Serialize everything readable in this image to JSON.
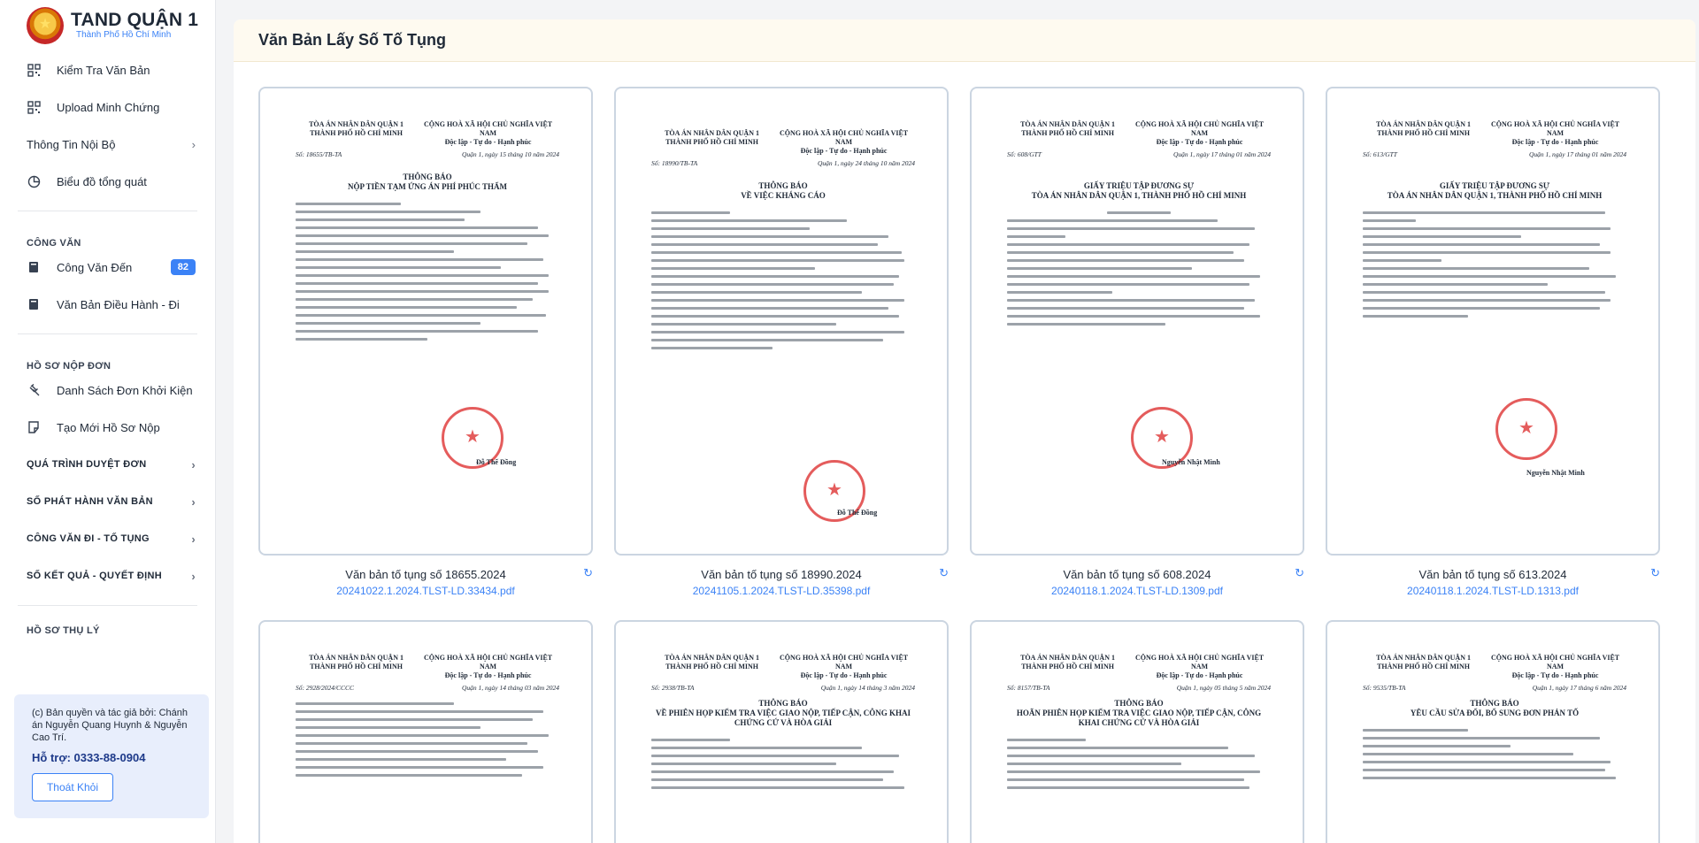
{
  "brand": {
    "title": "TAND QUẬN 1",
    "subtitle": "Thành Phố Hồ Chí Minh"
  },
  "nav": {
    "check_docs": "Kiểm Tra Văn Bản",
    "upload_proof": "Upload Minh Chứng",
    "internal_info": "Thông Tin Nội Bộ",
    "overview_chart": "Biểu đồ tổng quát",
    "section_official": "CÔNG VĂN",
    "incoming": "Công Văn Đến",
    "incoming_count": "82",
    "directives": "Văn Bản Điều Hành - Đi",
    "section_filing": "HỒ SƠ NỘP ĐƠN",
    "lawsuit_list": "Danh Sách Đơn Khởi Kiện",
    "new_filing": "Tạo Mới Hồ Sơ Nộp",
    "review_process": "QUÁ TRÌNH DUYỆT ĐƠN",
    "issued_docs": "SỐ PHÁT HÀNH VĂN BẢN",
    "outgoing_proceedings": "CÔNG VĂN ĐI - TỐ TỤNG",
    "results": "SỐ KẾT QUẢ - QUYẾT ĐỊNH",
    "section_cut": "HỒ SƠ THỤ LÝ"
  },
  "footer": {
    "copyright": "(c) Bản quyền và tác giả bởi: Chánh án Nguyễn Quang Huynh & Nguyễn Cao Trí.",
    "support": "Hỗ trợ: 0333-88-0904",
    "logout": "Thoát Khỏi"
  },
  "page": {
    "title": "Văn Bản Lấy Số Tố Tụng"
  },
  "scan": {
    "court": "TÒA ÁN NHÂN DÂN QUẬN 1",
    "city": "THÀNH PHỐ HỒ CHÍ MINH",
    "republic": "CỘNG HOÀ XÃ HỘI CHỦ NGHĨA VIỆT NAM",
    "motto": "Độc lập - Tự do - Hạnh phúc"
  },
  "documents": [
    {
      "title": "Văn bản tố tụng số 18655.2024",
      "file": "20241022.1.2024.TLST-LD.33434.pdf",
      "no": "Số: 18655/TB-TA",
      "date": "Quận 1, ngày 15 tháng 10 năm 2024",
      "heading": "THÔNG BÁO",
      "sub": "NỘP TIỀN TẠM ỨNG ÁN PHÍ PHÚC THẨM",
      "signer": "Đỗ Thế Đồng"
    },
    {
      "title": "Văn bản tố tụng số 18990.2024",
      "file": "20241105.1.2024.TLST-LD.35398.pdf",
      "no": "Số: 18990/TB-TA",
      "date": "Quận 1, ngày 24 tháng 10 năm 2024",
      "heading": "THÔNG BÁO",
      "sub": "VỀ VIỆC KHÁNG CÁO",
      "signer": "Đỗ Thế Đồng"
    },
    {
      "title": "Văn bản tố tụng số 608.2024",
      "file": "20240118.1.2024.TLST-LD.1309.pdf",
      "no": "Số: 608/GTT",
      "date": "Quận 1, ngày 17 tháng 01 năm 2024",
      "heading": "GIẤY TRIỆU TẬP ĐƯƠNG SỰ",
      "sub": "TÒA ÁN NHÂN DÂN QUẬN 1, THÀNH PHỐ HỒ CHÍ MINH",
      "signer": "Nguyễn Nhật Minh"
    },
    {
      "title": "Văn bản tố tụng số 613.2024",
      "file": "20240118.1.2024.TLST-LD.1313.pdf",
      "no": "Số: 613/GTT",
      "date": "Quận 1, ngày 17 tháng 01 năm 2024",
      "heading": "GIẤY TRIỆU TẬP ĐƯƠNG SỰ",
      "sub": "TÒA ÁN NHÂN DÂN QUẬN 1, THÀNH PHỐ HỒ CHÍ MINH",
      "signer": "Nguyễn Nhật Minh"
    },
    {
      "no": "Số: 2928/2024/CCCC",
      "date": "Quận 1, ngày 14 tháng 03 năm 2024",
      "heading": "",
      "sub": ""
    },
    {
      "no": "Số: 2938/TB-TA",
      "date": "Quận 1, ngày 14 tháng 3 năm 2024",
      "heading": "THÔNG BÁO",
      "sub": "VỀ PHIÊN HỌP KIỂM TRA VIỆC GIAO NỘP, TIẾP CẬN, CÔNG KHAI CHỨNG CỨ VÀ HÒA GIẢI"
    },
    {
      "no": "Số: 8157/TB-TA",
      "date": "Quận 1, ngày 05 tháng 5 năm 2024",
      "heading": "THÔNG BÁO",
      "sub": "HOÃN PHIÊN HỌP KIỂM TRA VIỆC GIAO NỘP, TIẾP CẬN, CÔNG KHAI CHỨNG CỨ VÀ HÒA GIẢI"
    },
    {
      "no": "Số: 9535/TB-TA",
      "date": "Quận 1, ngày 17 tháng 6 năm 2024",
      "heading": "THÔNG BÁO",
      "sub": "YÊU CẦU SỬA ĐỔI, BỔ SUNG ĐƠN PHẢN TỐ"
    }
  ]
}
